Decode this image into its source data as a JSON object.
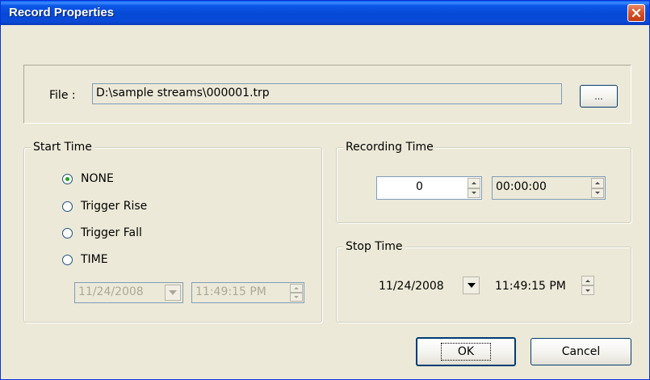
{
  "window": {
    "title": "Record Properties"
  },
  "file": {
    "label": "File :",
    "path": "D:\\sample streams\\000001.trp",
    "browse_label": "..."
  },
  "start_time": {
    "group_label": "Start Time",
    "options": [
      {
        "label": "NONE",
        "checked": true
      },
      {
        "label": "Trigger Rise",
        "checked": false
      },
      {
        "label": "Trigger Fall",
        "checked": false
      },
      {
        "label": "TIME",
        "checked": false
      }
    ],
    "date": "11/24/2008",
    "time": "11:49:15 PM"
  },
  "recording_time": {
    "group_label": "Recording Time",
    "count": "0",
    "duration": "00:00:00"
  },
  "stop_time": {
    "group_label": "Stop Time",
    "date": "11/24/2008",
    "time": "11:49:15 PM"
  },
  "buttons": {
    "ok": "OK",
    "cancel": "Cancel"
  }
}
